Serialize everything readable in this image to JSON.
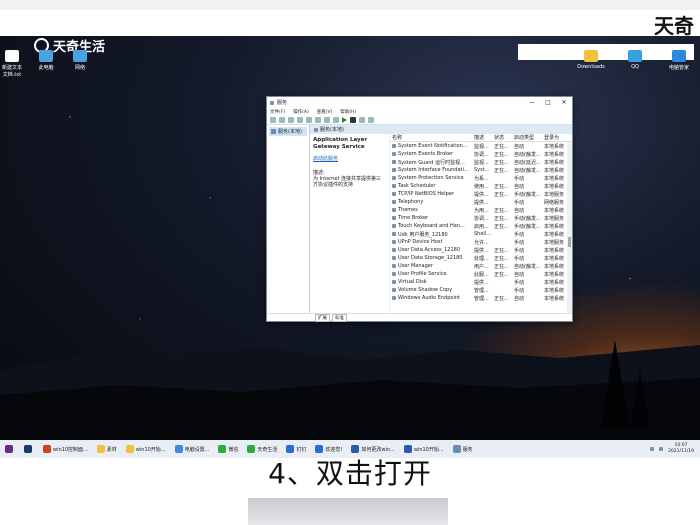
{
  "corner_logo": "天奇",
  "brand": "天奇生活",
  "desktop_left": [
    {
      "label": "新建文本文档.txt",
      "color": "#ffffff"
    },
    {
      "label": "此电脑",
      "color": "#4aa3df"
    },
    {
      "label": "网络",
      "color": "#4aa3df"
    }
  ],
  "desktop_right": [
    {
      "label": "Downloads",
      "color": "#f0c040"
    },
    {
      "label": "QQ",
      "color": "#3aa0e0"
    },
    {
      "label": "电脑管家",
      "color": "#2a8ae0"
    }
  ],
  "window": {
    "title": "服务",
    "controls": [
      "—",
      "□",
      "✕"
    ],
    "menu": [
      "文件(F)",
      "操作(A)",
      "查看(V)",
      "帮助(H)"
    ],
    "tree_label": "服务(本地)",
    "header_label": "服务(本地)",
    "selected_service": "Application Layer Gateway Service",
    "start_link": "启动此服务",
    "desc_label": "描述:",
    "desc_text": "为 Internet 连接共享提供第三方协议插件的支持",
    "columns": [
      "名称",
      "描述",
      "状态",
      "启动类型",
      "登录为"
    ],
    "rows": [
      [
        "System Event Notification...",
        "监视...",
        "正在...",
        "自动",
        "本地系统"
      ],
      [
        "System Events Broker",
        "协调...",
        "正在...",
        "自动(触发...",
        "本地系统"
      ],
      [
        "System Guard 运行时监视...",
        "监视...",
        "正在...",
        "自动(延迟...",
        "本地系统"
      ],
      [
        "System Interface Foundati...",
        "Syst...",
        "正在...",
        "自动(触发...",
        "本地系统"
      ],
      [
        "System Protection Service",
        "为系...",
        "",
        "手动",
        "本地系统"
      ],
      [
        "Task Scheduler",
        "使用...",
        "正在...",
        "自动",
        "本地系统"
      ],
      [
        "TCP/IP NetBIOS Helper",
        "提供...",
        "正在...",
        "手动(触发...",
        "本地服务"
      ],
      [
        "Telephony",
        "提供...",
        "",
        "手动",
        "网络服务"
      ],
      [
        "Themes",
        "为用...",
        "正在...",
        "自动",
        "本地系统"
      ],
      [
        "Time Broker",
        "协调...",
        "正在...",
        "手动(触发...",
        "本地服务"
      ],
      [
        "Touch Keyboard and Han...",
        "启用...",
        "正在...",
        "手动(触发...",
        "本地系统"
      ],
      [
        "Udk 用户服务_12180",
        "Shell...",
        "",
        "手动",
        "本地系统"
      ],
      [
        "UPnP Device Host",
        "允许...",
        "",
        "手动",
        "本地服务"
      ],
      [
        "User Data Access_12180",
        "提供...",
        "正在...",
        "手动",
        "本地系统"
      ],
      [
        "User Data Storage_12180",
        "处理...",
        "正在...",
        "手动",
        "本地系统"
      ],
      [
        "User Manager",
        "用户...",
        "正在...",
        "自动(触发...",
        "本地系统"
      ],
      [
        "User Profile Service",
        "此服...",
        "正在...",
        "自动",
        "本地系统"
      ],
      [
        "Virtual Disk",
        "提供...",
        "",
        "手动",
        "本地系统"
      ],
      [
        "Volume Shadow Copy",
        "管理...",
        "",
        "手动",
        "本地系统"
      ],
      [
        "Windows Audio Endpoint",
        "管理...",
        "正在...",
        "自动",
        "本地系统"
      ]
    ],
    "tabs": [
      "扩展",
      "标准"
    ]
  },
  "taskbar": {
    "items": [
      {
        "label": "",
        "color": "#6a2a8a"
      },
      {
        "label": "",
        "color": "#1a3a6a"
      },
      {
        "label": "win10控制面...",
        "color": "#d04020"
      },
      {
        "label": "素材",
        "color": "#f0c040"
      },
      {
        "label": "win10开始...",
        "color": "#f0c040"
      },
      {
        "label": "电脑设置...",
        "color": "#3a8ae0"
      },
      {
        "label": "微信",
        "color": "#2aae3a"
      },
      {
        "label": "天奇生活",
        "color": "#2aae3a"
      },
      {
        "label": "钉钉",
        "color": "#2a6ae0"
      },
      {
        "label": "欢迎您!",
        "color": "#2a6ae0"
      },
      {
        "label": "如何更改win...",
        "color": "#2a5ab0"
      },
      {
        "label": "win10开始...",
        "color": "#2a5ab0"
      },
      {
        "label": "服务",
        "color": "#6b8cb0"
      }
    ],
    "time": "10:07",
    "date": "2021/11/19"
  },
  "caption": "4、双击打开"
}
